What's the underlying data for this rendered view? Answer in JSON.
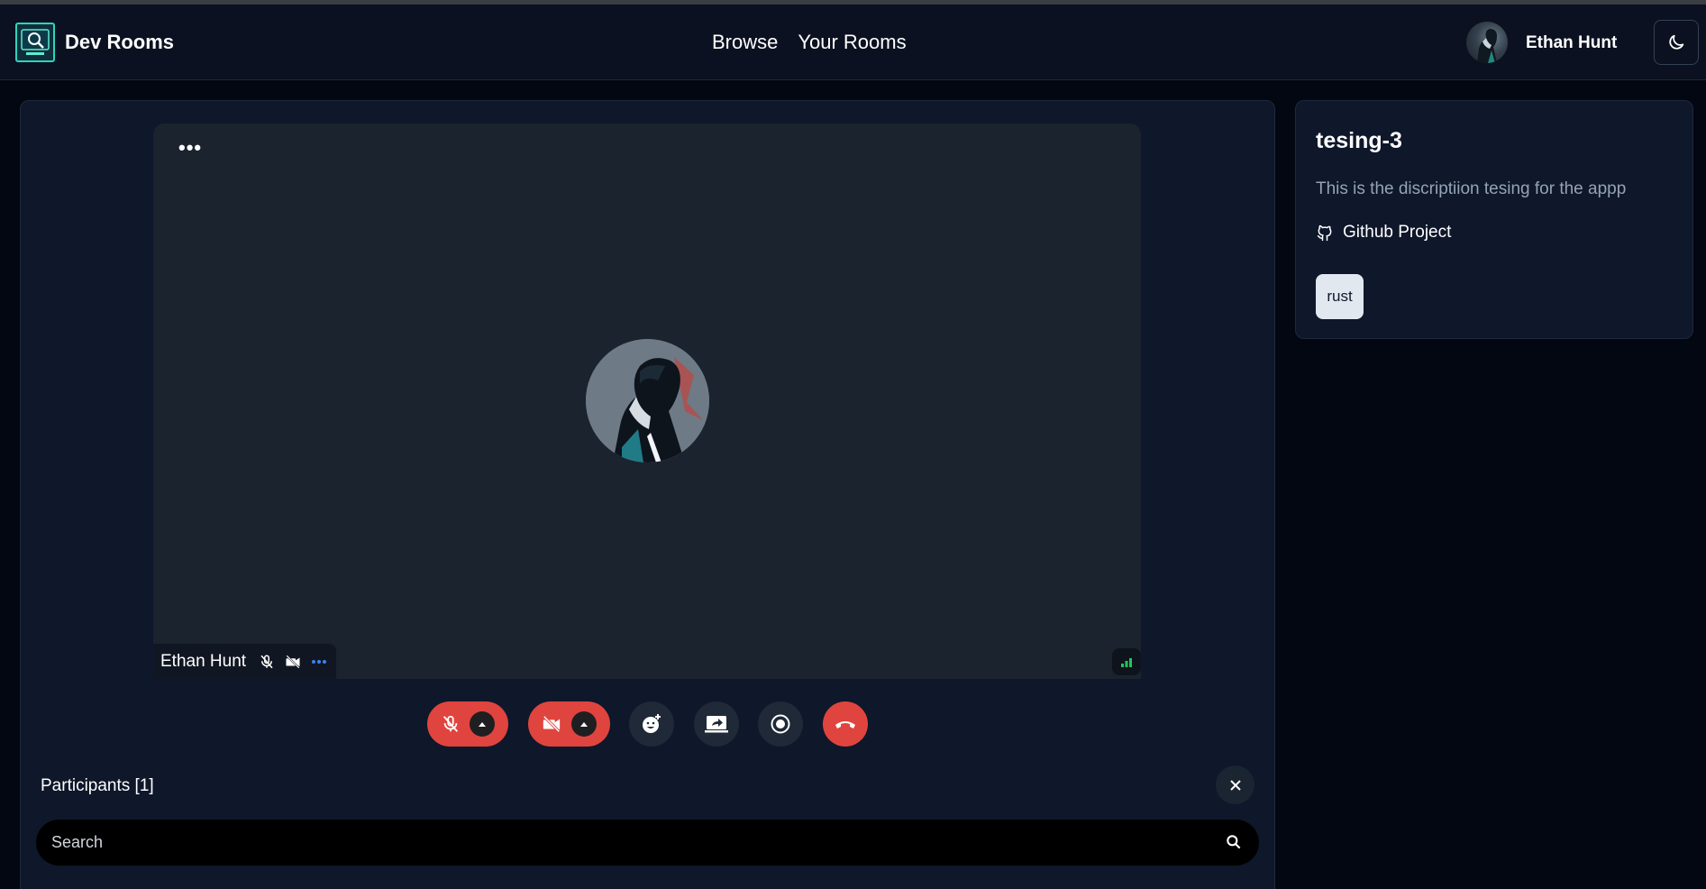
{
  "header": {
    "brand": "Dev Rooms",
    "nav": [
      {
        "label": "Browse"
      },
      {
        "label": "Your Rooms"
      }
    ],
    "user": {
      "name": "Ethan Hunt"
    },
    "theme_toggle_icon": "moon-icon"
  },
  "video": {
    "tile_menu": "•••",
    "participant_name": "Ethan Hunt",
    "mic_state": "mic-off-icon",
    "cam_state": "camera-off-icon",
    "signal_icon": "signal-bars-icon",
    "signal_color": "#22c55e"
  },
  "controls": [
    {
      "name": "mic-toggle",
      "icon": "mic-off-icon",
      "state": "off"
    },
    {
      "name": "camera-toggle",
      "icon": "camera-off-icon",
      "state": "off"
    },
    {
      "name": "reactions",
      "icon": "emoji-icon"
    },
    {
      "name": "screen-share",
      "icon": "screen-share-icon"
    },
    {
      "name": "record",
      "icon": "record-icon"
    },
    {
      "name": "leave",
      "icon": "hang-up-icon"
    }
  ],
  "participants": {
    "title": "Participants [1]",
    "search_placeholder": "Search"
  },
  "room": {
    "title": "tesing-3",
    "description": "This is the discriptiion tesing for the appp",
    "github_label": "Github Project",
    "tags": [
      "rust"
    ]
  },
  "colors": {
    "background": "#030712",
    "panel": "#0f172a",
    "accent_red": "#e0443e",
    "accent_teal": "#2dd4bf"
  }
}
